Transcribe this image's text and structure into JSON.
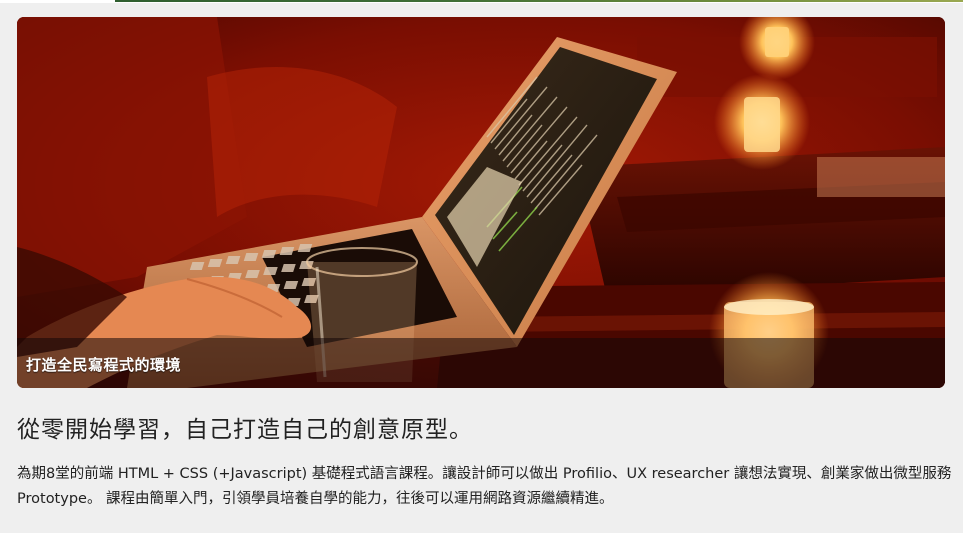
{
  "colors": {
    "page_background": "#efefef",
    "banner_base": "#5a0a00",
    "caption_text": "#ffffff",
    "body_text": "#222222"
  },
  "banner": {
    "image_subject": "laptop-with-code-editor-and-candles",
    "caption": "打造全民寫程式的環境"
  },
  "headline": "從零開始學習，自己打造自己的創意原型。",
  "description": "為期8堂的前端 HTML + CSS (+Javascript) 基礎程式語言課程。讓設計師可以做出 Profilio、UX researcher 讓想法實現、創業家做出微型服務 Prototype。 課程由簡單入門，引領學員培養自學的能力，往後可以運用網路資源繼續精進。"
}
